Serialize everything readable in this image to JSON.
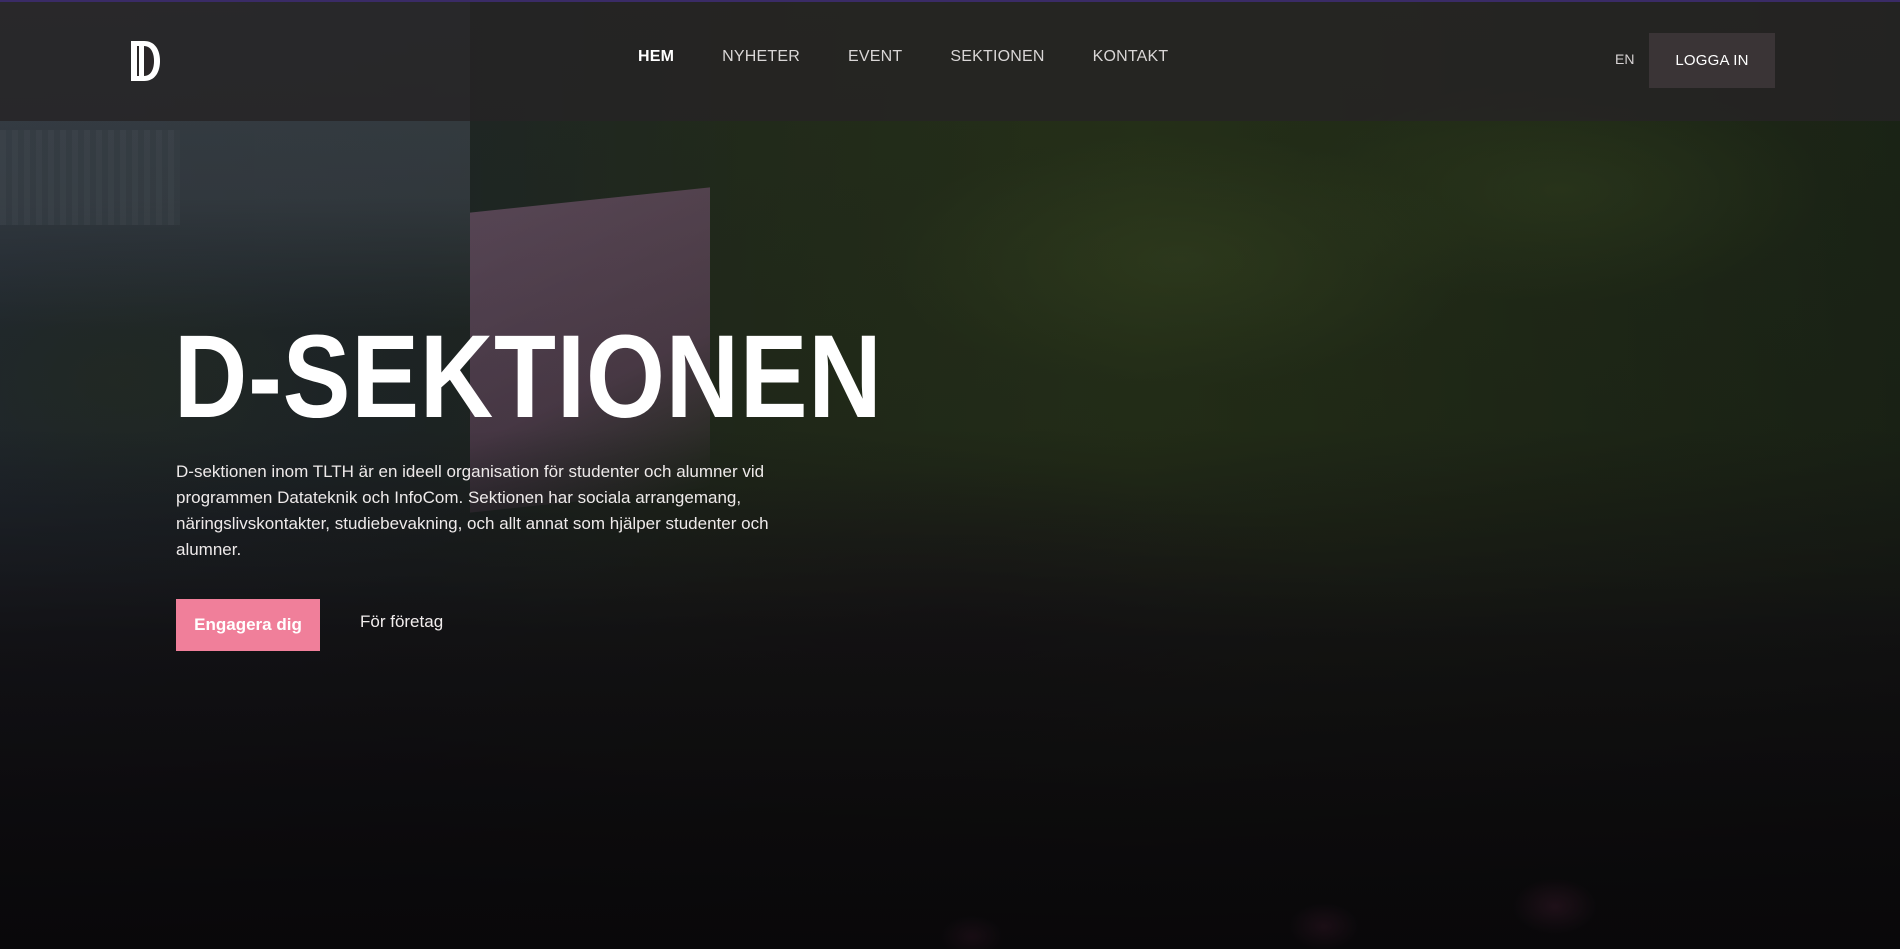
{
  "header": {
    "logo_icon": "d-sektionen-logo-icon",
    "nav": [
      {
        "label": "HEM",
        "active": true
      },
      {
        "label": "NYHETER",
        "active": false
      },
      {
        "label": "EVENT",
        "active": false
      },
      {
        "label": "SEKTIONEN",
        "active": false
      },
      {
        "label": "KONTAKT",
        "active": false
      }
    ],
    "language_label": "EN",
    "login_label": "LOGGA IN"
  },
  "hero": {
    "title": "D-SEKTIONEN",
    "description": "D-sektionen inom TLTH är en ideell organisation för studenter och alumner vid programmen Datateknik och InfoCom. Sektionen har sociala arrangemang, näringslivskontakter, studiebevakning, och allt annat som hjälper studenter och alumner.",
    "primary_button": "Engagera dig",
    "secondary_link": "För företag"
  },
  "colors": {
    "accent_pink": "#f07f9a",
    "header_bg": "#262324",
    "login_bg": "#3a3436",
    "top_accent_line": "#3a2b66"
  }
}
